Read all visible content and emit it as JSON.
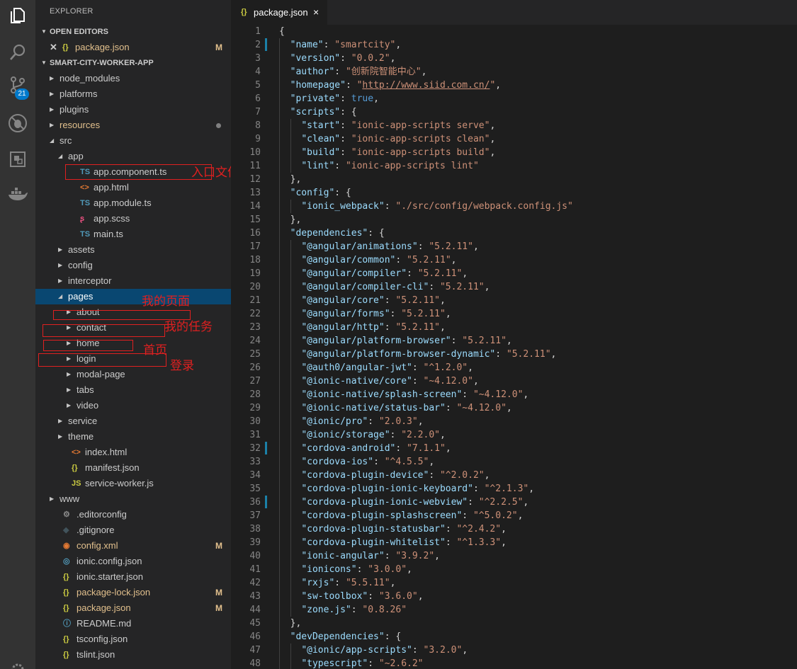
{
  "activity_bar": {
    "icons": [
      "files-icon",
      "search-icon",
      "source-control-icon",
      "debug-icon",
      "extensions-icon",
      "docker-icon"
    ],
    "scm_badge": "21"
  },
  "sidebar": {
    "title": "EXPLORER",
    "open_editors_label": "OPEN EDITORS",
    "open_editors": [
      {
        "name": "package.json",
        "status": "M"
      }
    ],
    "project_label": "SMART-CITY-WORKER-APP",
    "tree": [
      {
        "name": "node_modules",
        "kind": "folder",
        "depth": 0,
        "open": false,
        "modified": false
      },
      {
        "name": "platforms",
        "kind": "folder",
        "depth": 0,
        "open": false,
        "modified": false
      },
      {
        "name": "plugins",
        "kind": "folder",
        "depth": 0,
        "open": false,
        "modified": false
      },
      {
        "name": "resources",
        "kind": "folder",
        "depth": 0,
        "open": false,
        "modified": true,
        "dot": true
      },
      {
        "name": "src",
        "kind": "folder",
        "depth": 0,
        "open": true,
        "modified": false
      },
      {
        "name": "app",
        "kind": "folder",
        "depth": 1,
        "open": true,
        "modified": false
      },
      {
        "name": "app.component.ts",
        "kind": "file",
        "icon": "TS",
        "depth": 2
      },
      {
        "name": "app.html",
        "kind": "file",
        "icon": "<>",
        "depth": 2
      },
      {
        "name": "app.module.ts",
        "kind": "file",
        "icon": "TS",
        "depth": 2
      },
      {
        "name": "app.scss",
        "kind": "file",
        "icon": "sass",
        "depth": 2
      },
      {
        "name": "main.ts",
        "kind": "file",
        "icon": "TS",
        "depth": 2
      },
      {
        "name": "assets",
        "kind": "folder",
        "depth": 1,
        "open": false
      },
      {
        "name": "config",
        "kind": "folder",
        "depth": 1,
        "open": false
      },
      {
        "name": "interceptor",
        "kind": "folder",
        "depth": 1,
        "open": false
      },
      {
        "name": "pages",
        "kind": "folder",
        "depth": 1,
        "open": true,
        "selected": true
      },
      {
        "name": "about",
        "kind": "folder",
        "depth": 2,
        "open": false
      },
      {
        "name": "contact",
        "kind": "folder",
        "depth": 2,
        "open": false
      },
      {
        "name": "home",
        "kind": "folder",
        "depth": 2,
        "open": false
      },
      {
        "name": "login",
        "kind": "folder",
        "depth": 2,
        "open": false
      },
      {
        "name": "modal-page",
        "kind": "folder",
        "depth": 2,
        "open": false
      },
      {
        "name": "tabs",
        "kind": "folder",
        "depth": 2,
        "open": false
      },
      {
        "name": "video",
        "kind": "folder",
        "depth": 2,
        "open": false
      },
      {
        "name": "service",
        "kind": "folder",
        "depth": 1,
        "open": false
      },
      {
        "name": "theme",
        "kind": "folder",
        "depth": 1,
        "open": false
      },
      {
        "name": "index.html",
        "kind": "file",
        "icon": "<>",
        "depth": 1
      },
      {
        "name": "manifest.json",
        "kind": "file",
        "icon": "{}",
        "depth": 1
      },
      {
        "name": "service-worker.js",
        "kind": "file",
        "icon": "JS",
        "depth": 1
      },
      {
        "name": "www",
        "kind": "folder",
        "depth": 0,
        "open": false
      },
      {
        "name": ".editorconfig",
        "kind": "file",
        "icon": "gear",
        "depth": 0
      },
      {
        "name": ".gitignore",
        "kind": "file",
        "icon": "diamond",
        "depth": 0
      },
      {
        "name": "config.xml",
        "kind": "file",
        "icon": "rss",
        "depth": 0,
        "modified": true,
        "status": "M"
      },
      {
        "name": "ionic.config.json",
        "kind": "file",
        "icon": "ionic",
        "depth": 0
      },
      {
        "name": "ionic.starter.json",
        "kind": "file",
        "icon": "{}",
        "depth": 0
      },
      {
        "name": "package-lock.json",
        "kind": "file",
        "icon": "{}",
        "depth": 0,
        "modified": true,
        "status": "M"
      },
      {
        "name": "package.json",
        "kind": "file",
        "icon": "{}",
        "depth": 0,
        "modified": true,
        "status": "M"
      },
      {
        "name": "README.md",
        "kind": "file",
        "icon": "info",
        "depth": 0
      },
      {
        "name": "tsconfig.json",
        "kind": "file",
        "icon": "{}",
        "depth": 0
      },
      {
        "name": "tslint.json",
        "kind": "file",
        "icon": "{}",
        "depth": 0
      }
    ]
  },
  "annotations": [
    {
      "text": "入口文件",
      "color": "#e02020"
    },
    {
      "text": "我的页面",
      "color": "#e02020"
    },
    {
      "text": "我的任务",
      "color": "#e02020"
    },
    {
      "text": "首页",
      "color": "#e02020"
    },
    {
      "text": "登录",
      "color": "#e02020"
    }
  ],
  "editor": {
    "tab": {
      "icon": "{}",
      "name": "package.json",
      "close": "×"
    },
    "modified_lines": [
      2,
      32,
      36
    ],
    "lines": [
      [
        [
          "p",
          "{"
        ]
      ],
      [
        [
          "p",
          "  "
        ],
        [
          "k",
          "\"name\""
        ],
        [
          "p",
          ": "
        ],
        [
          "s",
          "\"smartcity\""
        ],
        [
          "p",
          ","
        ]
      ],
      [
        [
          "p",
          "  "
        ],
        [
          "k",
          "\"version\""
        ],
        [
          "p",
          ": "
        ],
        [
          "s",
          "\"0.0.2\""
        ],
        [
          "p",
          ","
        ]
      ],
      [
        [
          "p",
          "  "
        ],
        [
          "k",
          "\"author\""
        ],
        [
          "p",
          ": "
        ],
        [
          "s",
          "\"创新院智能中心\""
        ],
        [
          "p",
          ","
        ]
      ],
      [
        [
          "p",
          "  "
        ],
        [
          "k",
          "\"homepage\""
        ],
        [
          "p",
          ": "
        ],
        [
          "s",
          "\""
        ],
        [
          "u",
          "http://www.siid.com.cn/"
        ],
        [
          "s",
          "\""
        ],
        [
          "p",
          ","
        ]
      ],
      [
        [
          "p",
          "  "
        ],
        [
          "k",
          "\"private\""
        ],
        [
          "p",
          ": "
        ],
        [
          "b",
          "true"
        ],
        [
          "p",
          ","
        ]
      ],
      [
        [
          "p",
          "  "
        ],
        [
          "k",
          "\"scripts\""
        ],
        [
          "p",
          ": {"
        ]
      ],
      [
        [
          "p",
          "    "
        ],
        [
          "k",
          "\"start\""
        ],
        [
          "p",
          ": "
        ],
        [
          "s",
          "\"ionic-app-scripts serve\""
        ],
        [
          "p",
          ","
        ]
      ],
      [
        [
          "p",
          "    "
        ],
        [
          "k",
          "\"clean\""
        ],
        [
          "p",
          ": "
        ],
        [
          "s",
          "\"ionic-app-scripts clean\""
        ],
        [
          "p",
          ","
        ]
      ],
      [
        [
          "p",
          "    "
        ],
        [
          "k",
          "\"build\""
        ],
        [
          "p",
          ": "
        ],
        [
          "s",
          "\"ionic-app-scripts build\""
        ],
        [
          "p",
          ","
        ]
      ],
      [
        [
          "p",
          "    "
        ],
        [
          "k",
          "\"lint\""
        ],
        [
          "p",
          ": "
        ],
        [
          "s",
          "\"ionic-app-scripts lint\""
        ]
      ],
      [
        [
          "p",
          "  },"
        ]
      ],
      [
        [
          "p",
          "  "
        ],
        [
          "k",
          "\"config\""
        ],
        [
          "p",
          ": {"
        ]
      ],
      [
        [
          "p",
          "    "
        ],
        [
          "k",
          "\"ionic_webpack\""
        ],
        [
          "p",
          ": "
        ],
        [
          "s",
          "\"./src/config/webpack.config.js\""
        ]
      ],
      [
        [
          "p",
          "  },"
        ]
      ],
      [
        [
          "p",
          "  "
        ],
        [
          "k",
          "\"dependencies\""
        ],
        [
          "p",
          ": {"
        ]
      ],
      [
        [
          "p",
          "    "
        ],
        [
          "k",
          "\"@angular/animations\""
        ],
        [
          "p",
          ": "
        ],
        [
          "s",
          "\"5.2.11\""
        ],
        [
          "p",
          ","
        ]
      ],
      [
        [
          "p",
          "    "
        ],
        [
          "k",
          "\"@angular/common\""
        ],
        [
          "p",
          ": "
        ],
        [
          "s",
          "\"5.2.11\""
        ],
        [
          "p",
          ","
        ]
      ],
      [
        [
          "p",
          "    "
        ],
        [
          "k",
          "\"@angular/compiler\""
        ],
        [
          "p",
          ": "
        ],
        [
          "s",
          "\"5.2.11\""
        ],
        [
          "p",
          ","
        ]
      ],
      [
        [
          "p",
          "    "
        ],
        [
          "k",
          "\"@angular/compiler-cli\""
        ],
        [
          "p",
          ": "
        ],
        [
          "s",
          "\"5.2.11\""
        ],
        [
          "p",
          ","
        ]
      ],
      [
        [
          "p",
          "    "
        ],
        [
          "k",
          "\"@angular/core\""
        ],
        [
          "p",
          ": "
        ],
        [
          "s",
          "\"5.2.11\""
        ],
        [
          "p",
          ","
        ]
      ],
      [
        [
          "p",
          "    "
        ],
        [
          "k",
          "\"@angular/forms\""
        ],
        [
          "p",
          ": "
        ],
        [
          "s",
          "\"5.2.11\""
        ],
        [
          "p",
          ","
        ]
      ],
      [
        [
          "p",
          "    "
        ],
        [
          "k",
          "\"@angular/http\""
        ],
        [
          "p",
          ": "
        ],
        [
          "s",
          "\"5.2.11\""
        ],
        [
          "p",
          ","
        ]
      ],
      [
        [
          "p",
          "    "
        ],
        [
          "k",
          "\"@angular/platform-browser\""
        ],
        [
          "p",
          ": "
        ],
        [
          "s",
          "\"5.2.11\""
        ],
        [
          "p",
          ","
        ]
      ],
      [
        [
          "p",
          "    "
        ],
        [
          "k",
          "\"@angular/platform-browser-dynamic\""
        ],
        [
          "p",
          ": "
        ],
        [
          "s",
          "\"5.2.11\""
        ],
        [
          "p",
          ","
        ]
      ],
      [
        [
          "p",
          "    "
        ],
        [
          "k",
          "\"@auth0/angular-jwt\""
        ],
        [
          "p",
          ": "
        ],
        [
          "s",
          "\"^1.2.0\""
        ],
        [
          "p",
          ","
        ]
      ],
      [
        [
          "p",
          "    "
        ],
        [
          "k",
          "\"@ionic-native/core\""
        ],
        [
          "p",
          ": "
        ],
        [
          "s",
          "\"~4.12.0\""
        ],
        [
          "p",
          ","
        ]
      ],
      [
        [
          "p",
          "    "
        ],
        [
          "k",
          "\"@ionic-native/splash-screen\""
        ],
        [
          "p",
          ": "
        ],
        [
          "s",
          "\"~4.12.0\""
        ],
        [
          "p",
          ","
        ]
      ],
      [
        [
          "p",
          "    "
        ],
        [
          "k",
          "\"@ionic-native/status-bar\""
        ],
        [
          "p",
          ": "
        ],
        [
          "s",
          "\"~4.12.0\""
        ],
        [
          "p",
          ","
        ]
      ],
      [
        [
          "p",
          "    "
        ],
        [
          "k",
          "\"@ionic/pro\""
        ],
        [
          "p",
          ": "
        ],
        [
          "s",
          "\"2.0.3\""
        ],
        [
          "p",
          ","
        ]
      ],
      [
        [
          "p",
          "    "
        ],
        [
          "k",
          "\"@ionic/storage\""
        ],
        [
          "p",
          ": "
        ],
        [
          "s",
          "\"2.2.0\""
        ],
        [
          "p",
          ","
        ]
      ],
      [
        [
          "p",
          "    "
        ],
        [
          "k",
          "\"cordova-android\""
        ],
        [
          "p",
          ": "
        ],
        [
          "s",
          "\"7.1.1\""
        ],
        [
          "p",
          ","
        ]
      ],
      [
        [
          "p",
          "    "
        ],
        [
          "k",
          "\"cordova-ios\""
        ],
        [
          "p",
          ": "
        ],
        [
          "s",
          "\"^4.5.5\""
        ],
        [
          "p",
          ","
        ]
      ],
      [
        [
          "p",
          "    "
        ],
        [
          "k",
          "\"cordova-plugin-device\""
        ],
        [
          "p",
          ": "
        ],
        [
          "s",
          "\"^2.0.2\""
        ],
        [
          "p",
          ","
        ]
      ],
      [
        [
          "p",
          "    "
        ],
        [
          "k",
          "\"cordova-plugin-ionic-keyboard\""
        ],
        [
          "p",
          ": "
        ],
        [
          "s",
          "\"^2.1.3\""
        ],
        [
          "p",
          ","
        ]
      ],
      [
        [
          "p",
          "    "
        ],
        [
          "k",
          "\"cordova-plugin-ionic-webview\""
        ],
        [
          "p",
          ": "
        ],
        [
          "s",
          "\"^2.2.5\""
        ],
        [
          "p",
          ","
        ]
      ],
      [
        [
          "p",
          "    "
        ],
        [
          "k",
          "\"cordova-plugin-splashscreen\""
        ],
        [
          "p",
          ": "
        ],
        [
          "s",
          "\"^5.0.2\""
        ],
        [
          "p",
          ","
        ]
      ],
      [
        [
          "p",
          "    "
        ],
        [
          "k",
          "\"cordova-plugin-statusbar\""
        ],
        [
          "p",
          ": "
        ],
        [
          "s",
          "\"^2.4.2\""
        ],
        [
          "p",
          ","
        ]
      ],
      [
        [
          "p",
          "    "
        ],
        [
          "k",
          "\"cordova-plugin-whitelist\""
        ],
        [
          "p",
          ": "
        ],
        [
          "s",
          "\"^1.3.3\""
        ],
        [
          "p",
          ","
        ]
      ],
      [
        [
          "p",
          "    "
        ],
        [
          "k",
          "\"ionic-angular\""
        ],
        [
          "p",
          ": "
        ],
        [
          "s",
          "\"3.9.2\""
        ],
        [
          "p",
          ","
        ]
      ],
      [
        [
          "p",
          "    "
        ],
        [
          "k",
          "\"ionicons\""
        ],
        [
          "p",
          ": "
        ],
        [
          "s",
          "\"3.0.0\""
        ],
        [
          "p",
          ","
        ]
      ],
      [
        [
          "p",
          "    "
        ],
        [
          "k",
          "\"rxjs\""
        ],
        [
          "p",
          ": "
        ],
        [
          "s",
          "\"5.5.11\""
        ],
        [
          "p",
          ","
        ]
      ],
      [
        [
          "p",
          "    "
        ],
        [
          "k",
          "\"sw-toolbox\""
        ],
        [
          "p",
          ": "
        ],
        [
          "s",
          "\"3.6.0\""
        ],
        [
          "p",
          ","
        ]
      ],
      [
        [
          "p",
          "    "
        ],
        [
          "k",
          "\"zone.js\""
        ],
        [
          "p",
          ": "
        ],
        [
          "s",
          "\"0.8.26\""
        ]
      ],
      [
        [
          "p",
          "  },"
        ]
      ],
      [
        [
          "p",
          "  "
        ],
        [
          "k",
          "\"devDependencies\""
        ],
        [
          "p",
          ": {"
        ]
      ],
      [
        [
          "p",
          "    "
        ],
        [
          "k",
          "\"@ionic/app-scripts\""
        ],
        [
          "p",
          ": "
        ],
        [
          "s",
          "\"3.2.0\""
        ],
        [
          "p",
          ","
        ]
      ],
      [
        [
          "p",
          "    "
        ],
        [
          "k",
          "\"typescript\""
        ],
        [
          "p",
          ": "
        ],
        [
          "s",
          "\"~2.6.2\""
        ]
      ]
    ]
  }
}
